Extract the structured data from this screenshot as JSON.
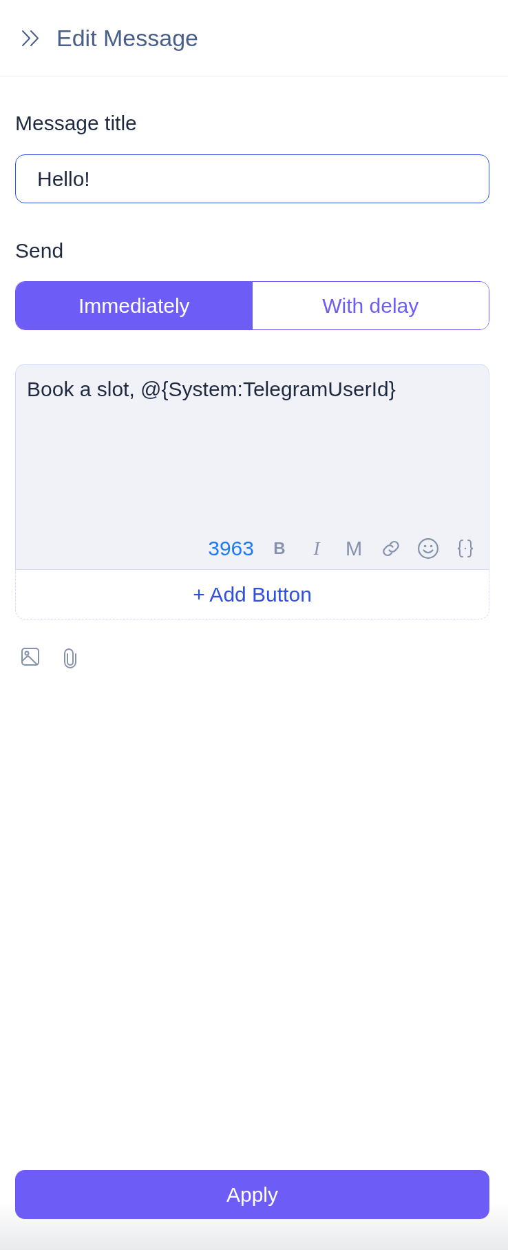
{
  "header": {
    "title": "Edit Message"
  },
  "title_field": {
    "label": "Message title",
    "value": "Hello!",
    "focused": true
  },
  "send": {
    "label": "Send",
    "options": [
      {
        "label": "Immediately",
        "selected": true
      },
      {
        "label": "With delay",
        "selected": false
      }
    ]
  },
  "editor": {
    "text": "Book a slot, @{System:TelegramUserId}",
    "char_count": "3963",
    "tools": [
      {
        "kind": "bold",
        "label": "B"
      },
      {
        "kind": "italic",
        "label": "I"
      },
      {
        "kind": "mono",
        "label": "M"
      },
      {
        "kind": "link"
      },
      {
        "kind": "emoji"
      },
      {
        "kind": "variable"
      }
    ]
  },
  "add_button": {
    "label": "+ Add Button"
  },
  "apply_button": {
    "label": "Apply"
  }
}
